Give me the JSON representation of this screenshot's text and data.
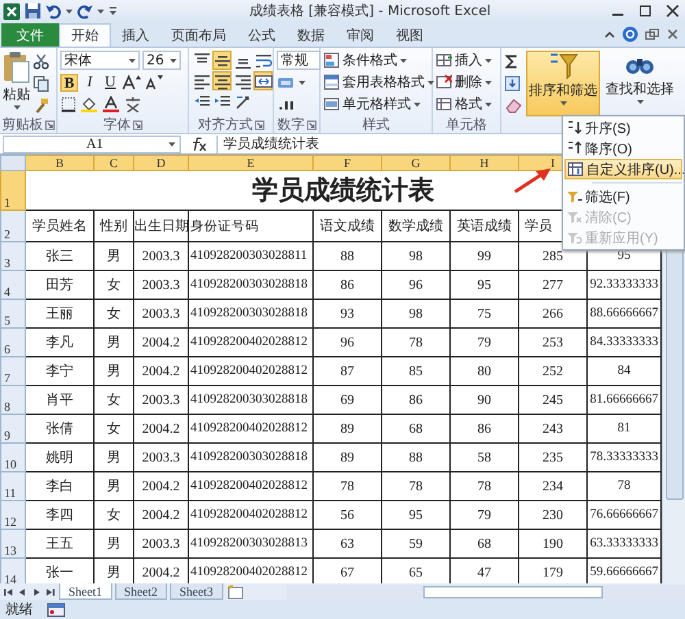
{
  "window": {
    "title": "成绩表格 [兼容模式] - Microsoft Excel"
  },
  "tabs": [
    {
      "label": "文件",
      "kind": "file",
      "selected": false
    },
    {
      "label": "开始",
      "kind": "tab",
      "selected": true
    },
    {
      "label": "插入",
      "kind": "tab",
      "selected": false
    },
    {
      "label": "页面布局",
      "kind": "tab",
      "selected": false
    },
    {
      "label": "公式",
      "kind": "tab",
      "selected": false
    },
    {
      "label": "数据",
      "kind": "tab",
      "selected": false
    },
    {
      "label": "审阅",
      "kind": "tab",
      "selected": false
    },
    {
      "label": "视图",
      "kind": "tab",
      "selected": false
    }
  ],
  "ribbon": {
    "groups": [
      {
        "kind": "clipboard",
        "label": "剪贴板",
        "buttons": [
          {
            "label": "粘贴"
          }
        ]
      },
      {
        "kind": "font",
        "label": "字体",
        "font": "宋体",
        "size": "26",
        "toggles": [
          {
            "label": "B",
            "selected": true
          },
          {
            "label": "I",
            "selected": false
          },
          {
            "label": "U",
            "selected": false
          }
        ]
      },
      {
        "kind": "alignment",
        "label": "对齐方式",
        "buttons": [
          {
            "selected": false
          },
          {
            "selected": true
          },
          {
            "selected": false
          },
          {
            "selected": false
          },
          {
            "selected": false
          },
          {
            "selected": true
          },
          {
            "selected": false
          },
          {
            "selected": true
          },
          {
            "selected": false
          },
          {
            "selected": false
          },
          {
            "selected": false
          }
        ]
      },
      {
        "kind": "number",
        "label": "数字",
        "format": "常规"
      },
      {
        "kind": "styles",
        "label": "样式",
        "buttons": [
          {
            "label": "条件格式"
          },
          {
            "label": "套用表格格式"
          },
          {
            "label": "单元格样式"
          }
        ]
      },
      {
        "kind": "cells",
        "label": "单元格",
        "buttons": [
          {
            "label": "插入"
          },
          {
            "label": "删除"
          },
          {
            "label": "格式"
          }
        ]
      },
      {
        "kind": "editing",
        "buttons": [
          {
            "label": "排序和筛选",
            "selected": true
          },
          {
            "label": "查找和选择",
            "selected": false
          }
        ]
      }
    ]
  },
  "sort_menu": {
    "items": [
      {
        "label": "升序(S)",
        "disabled": false,
        "selected": false,
        "divider_above": false
      },
      {
        "label": "降序(O)",
        "disabled": false,
        "selected": false,
        "divider_above": false
      },
      {
        "label": "自定义排序(U)...",
        "disabled": false,
        "selected": true,
        "divider_above": false
      },
      {
        "label": "筛选(F)",
        "disabled": false,
        "selected": false,
        "divider_above": true
      },
      {
        "label": "清除(C)",
        "disabled": true,
        "selected": false,
        "divider_above": false
      },
      {
        "label": "重新应用(Y)",
        "disabled": true,
        "selected": false,
        "divider_above": false
      }
    ]
  },
  "formula_bar": {
    "name_box": "A1",
    "formula": "学员成绩统计表"
  },
  "sheet": {
    "columns": [
      {
        "label": "B",
        "selected": true
      },
      {
        "label": "C",
        "selected": true
      },
      {
        "label": "D",
        "selected": true
      },
      {
        "label": "E",
        "selected": true
      },
      {
        "label": "F",
        "selected": true
      },
      {
        "label": "G",
        "selected": true
      },
      {
        "label": "H",
        "selected": true
      },
      {
        "label": "I",
        "selected": true
      }
    ],
    "title": "学员成绩统计表",
    "rows": [
      {
        "number": "1",
        "kind": "title",
        "selected": true
      },
      {
        "number": "2",
        "kind": "header",
        "selected": false,
        "cells": [
          "学员姓名",
          "性别",
          "出生日期",
          "身份证号码",
          "语文成绩",
          "数学成绩",
          "英语成绩",
          "学员"
        ]
      },
      {
        "number": "3",
        "kind": "data",
        "selected": false,
        "cells": [
          "张三",
          "男",
          "2003.3",
          "410928200303028811",
          "88",
          "98",
          "99",
          "285",
          "95"
        ]
      },
      {
        "number": "4",
        "kind": "data",
        "selected": false,
        "cells": [
          "田芳",
          "女",
          "2003.3",
          "410928200303028818",
          "86",
          "96",
          "95",
          "277",
          "92.33333333"
        ]
      },
      {
        "number": "5",
        "kind": "data",
        "selected": false,
        "cells": [
          "王丽",
          "女",
          "2003.3",
          "410928200303028818",
          "93",
          "98",
          "75",
          "266",
          "88.66666667"
        ]
      },
      {
        "number": "6",
        "kind": "data",
        "selected": false,
        "cells": [
          "李凡",
          "男",
          "2004.2",
          "410928200402028812",
          "96",
          "78",
          "79",
          "253",
          "84.33333333"
        ]
      },
      {
        "number": "7",
        "kind": "data",
        "selected": false,
        "cells": [
          "李宁",
          "男",
          "2004.2",
          "410928200402028812",
          "87",
          "85",
          "80",
          "252",
          "84"
        ]
      },
      {
        "number": "8",
        "kind": "data",
        "selected": false,
        "cells": [
          "肖平",
          "女",
          "2003.3",
          "410928200303028818",
          "69",
          "86",
          "90",
          "245",
          "81.66666667"
        ]
      },
      {
        "number": "9",
        "kind": "data",
        "selected": false,
        "cells": [
          "张倩",
          "女",
          "2004.2",
          "410928200402028812",
          "89",
          "68",
          "86",
          "243",
          "81"
        ]
      },
      {
        "number": "10",
        "kind": "data",
        "selected": false,
        "cells": [
          "姚明",
          "男",
          "2003.3",
          "410928200303028818",
          "89",
          "88",
          "58",
          "235",
          "78.33333333"
        ]
      },
      {
        "number": "11",
        "kind": "data",
        "selected": false,
        "cells": [
          "李白",
          "男",
          "2004.2",
          "410928200402028812",
          "78",
          "78",
          "78",
          "234",
          "78"
        ]
      },
      {
        "number": "12",
        "kind": "data",
        "selected": false,
        "cells": [
          "李四",
          "女",
          "2004.2",
          "410928200402028812",
          "56",
          "95",
          "79",
          "230",
          "76.66666667"
        ]
      },
      {
        "number": "13",
        "kind": "data",
        "selected": false,
        "cells": [
          "王五",
          "男",
          "2003.3",
          "410928200303028813",
          "63",
          "59",
          "68",
          "190",
          "63.33333333"
        ]
      },
      {
        "number": "14",
        "kind": "data",
        "selected": false,
        "cells": [
          "张一",
          "男",
          "2004.2",
          "410928200402028812",
          "67",
          "65",
          "47",
          "179",
          "59.66666667"
        ]
      }
    ]
  },
  "sheet_tabs": [
    {
      "label": "Sheet1",
      "selected": true
    },
    {
      "label": "Sheet2",
      "selected": false
    },
    {
      "label": "Sheet3",
      "selected": false
    }
  ],
  "status_bar": {
    "text": "就绪"
  }
}
